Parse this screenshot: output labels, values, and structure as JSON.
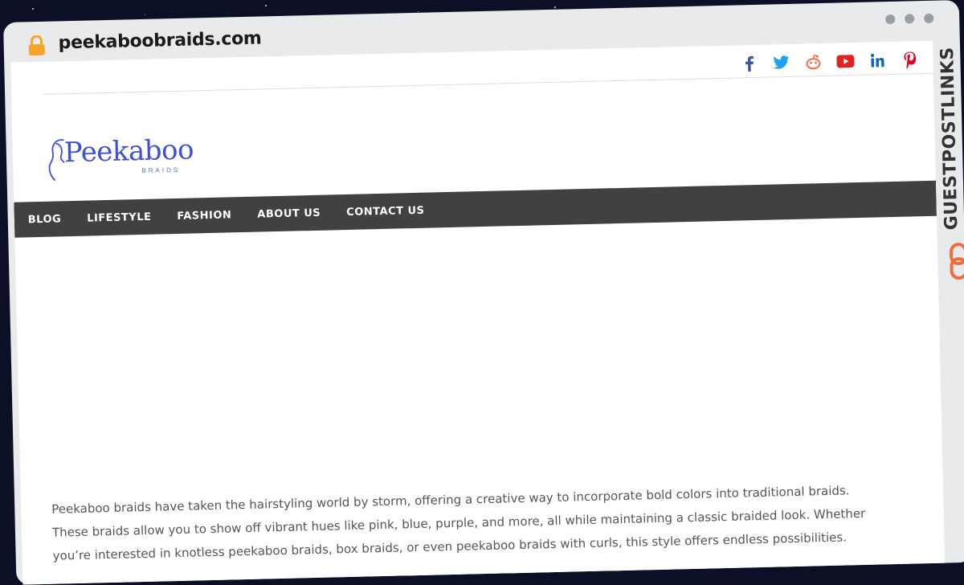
{
  "browser": {
    "url": "peekaboobraids.com"
  },
  "social": [
    {
      "name": "facebook",
      "color": "#3b5998"
    },
    {
      "name": "twitter",
      "color": "#1da1f2"
    },
    {
      "name": "reddit",
      "color": "#ff6a3d"
    },
    {
      "name": "youtube",
      "color": "#e02424"
    },
    {
      "name": "linkedin",
      "color": "#0a66c2"
    },
    {
      "name": "pinterest",
      "color": "#e60023"
    }
  ],
  "logo": {
    "title": "Peekaboo",
    "subtitle": "BRAIDS",
    "color": "#3f4fd6"
  },
  "nav": {
    "items": [
      "BLOG",
      "LIFESTYLE",
      "FASHION",
      "ABOUT US",
      "CONTACT US"
    ]
  },
  "article": {
    "intro": "Peekaboo braids have taken the hairstyling world by storm, offering a creative way to incorporate bold colors into traditional braids. These braids allow you to show off vibrant hues like pink, blue, purple, and more, all while maintaining a classic braided look. Whether you’re interested in knotless peekaboo braids, box braids, or even peekaboo braids with curls, this style offers endless possibilities."
  },
  "brand": {
    "name": "GUESTPOSTLINKS",
    "accent": "#f26b3a"
  }
}
